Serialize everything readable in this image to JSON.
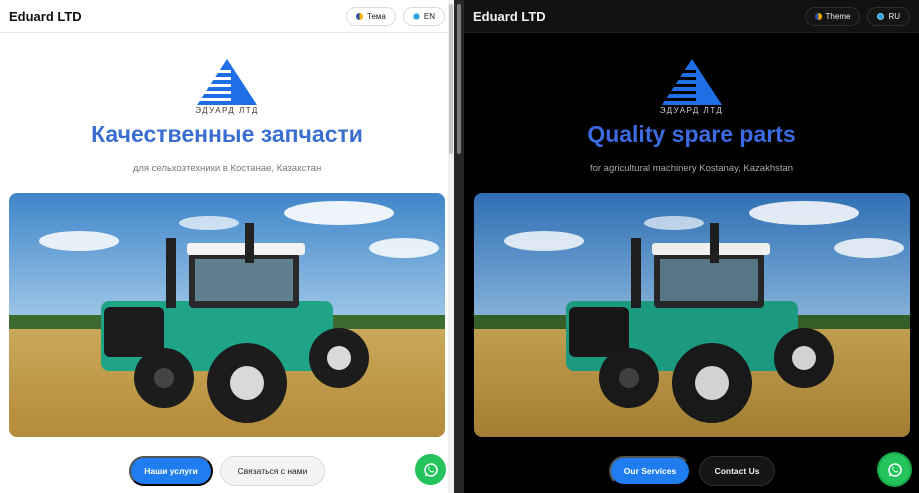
{
  "light": {
    "brand": "Eduard LTD",
    "theme_label": "Тема",
    "lang_label": "EN",
    "logo_text": "ЭДУАРД ЛТД",
    "headline": "Качественные запчасти",
    "subline": "для сельхозтехники в Костанае, Казахстан",
    "primary_cta": "Наши услуги",
    "secondary_cta": "Связаться с нами"
  },
  "dark": {
    "brand": "Eduard LTD",
    "theme_label": "Theme",
    "lang_label": "RU",
    "logo_text": "ЭДУАРД ЛТД",
    "headline": "Quality spare parts",
    "subline": "for agricultural machinery Kostanay, Kazakhstan",
    "primary_cta": "Our Services",
    "secondary_cta": "Contact Us"
  },
  "icons": {
    "theme": "half-circle-icon",
    "language": "globe-icon",
    "chat": "whatsapp-icon"
  },
  "colors": {
    "accent": "#1f7df0",
    "headline_light": "#3a6fd0",
    "headline_dark": "#3d6ae0",
    "tractor_body": "#1fa487",
    "whatsapp": "#25c35b"
  }
}
